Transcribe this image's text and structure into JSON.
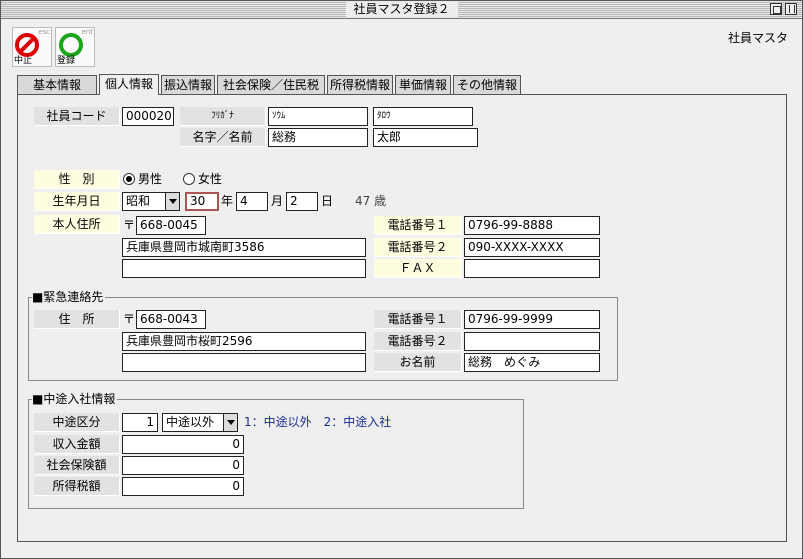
{
  "window": {
    "title": "社員マスタ登録２"
  },
  "toolbar": {
    "stop_label": "中止",
    "stop_hint": "esc",
    "save_label": "登録",
    "save_hint": "ent",
    "app_label": "社員マスタ"
  },
  "tabs": [
    {
      "label": "基本情報"
    },
    {
      "label": "個人情報"
    },
    {
      "label": "振込情報"
    },
    {
      "label": "社会保険／住民税"
    },
    {
      "label": "所得税情報"
    },
    {
      "label": "単価情報"
    },
    {
      "label": "その他情報"
    }
  ],
  "employee": {
    "code_label": "社員コード",
    "code": "000020",
    "kana_label": "ﾌﾘｶﾞﾅ",
    "kana_last": "ｿｳﾑ",
    "kana_first": "ﾀﾛｳ",
    "name_label": "名字／名前",
    "last_name": "総務",
    "first_name": "太郎"
  },
  "gender": {
    "label": "性　別",
    "male": "男性",
    "female": "女性",
    "selected": "male"
  },
  "birth": {
    "label": "生年月日",
    "era": "昭和",
    "year": "30",
    "year_unit": "年",
    "month": "4",
    "month_unit": "月",
    "day": "2",
    "day_unit": "日",
    "age": "47 歳"
  },
  "address": {
    "label": "本人住所",
    "postal_mark": "〒",
    "postal": "668-0045",
    "line1": "兵庫県豊岡市城南町3586",
    "line2": "",
    "phone1_label": "電話番号１",
    "phone1": "0796-99-8888",
    "phone2_label": "電話番号２",
    "phone2": "090-XXXX-XXXX",
    "fax_label": "ＦＡＸ",
    "fax": ""
  },
  "emergency": {
    "title": "■緊急連絡先",
    "address_label": "住　所",
    "postal_mark": "〒",
    "postal": "668-0043",
    "line1": "兵庫県豊岡市桜町2596",
    "line2": "",
    "phone1_label": "電話番号１",
    "phone1": "0796-99-9999",
    "phone2_label": "電話番号２",
    "phone2": "",
    "name_label": "お名前",
    "name": "総務　めぐみ"
  },
  "midcareer": {
    "title": "■中途入社情報",
    "type_label": "中途区分",
    "type_value": "1",
    "type_select": "中途以外",
    "type_hint": "1：中途以外　2：中途入社",
    "income_label": "収入金額",
    "income": "0",
    "insurance_label": "社会保険額",
    "insurance": "0",
    "tax_label": "所得税額",
    "tax": "0"
  }
}
